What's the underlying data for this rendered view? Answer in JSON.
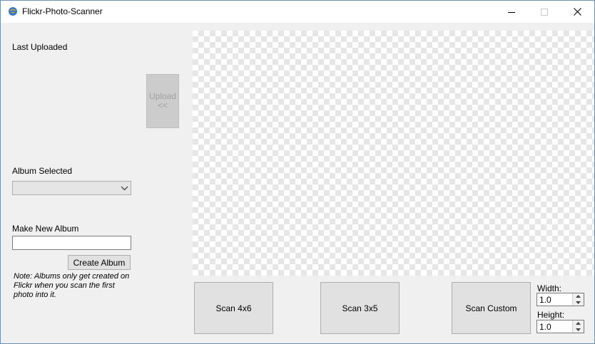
{
  "window": {
    "title": "Flickr-Photo-Scanner"
  },
  "left_panel": {
    "last_uploaded_label": "Last Uploaded",
    "upload_button": {
      "line1": "Upload",
      "line2": "<<"
    },
    "album_selected_label": "Album Selected",
    "album_dropdown_value": "",
    "make_new_album_label": "Make New Album",
    "new_album_input_value": "",
    "create_album_button": "Create Album",
    "note": "Note: Albums only get created on Flickr when you scan the first photo into it."
  },
  "scan_buttons": {
    "scan_4x6": "Scan 4x6",
    "scan_3x5": "Scan 3x5",
    "scan_custom": "Scan Custom"
  },
  "custom_size": {
    "width_label": "Width:",
    "width_value": "1.0",
    "height_label": "Height:",
    "height_value": "1.0"
  },
  "colors": {
    "window_bg": "#f0f0f0",
    "titlebar_bg": "#ffffff",
    "disabled_button_bg": "#cccccc",
    "button_bg": "#e1e1e1"
  }
}
